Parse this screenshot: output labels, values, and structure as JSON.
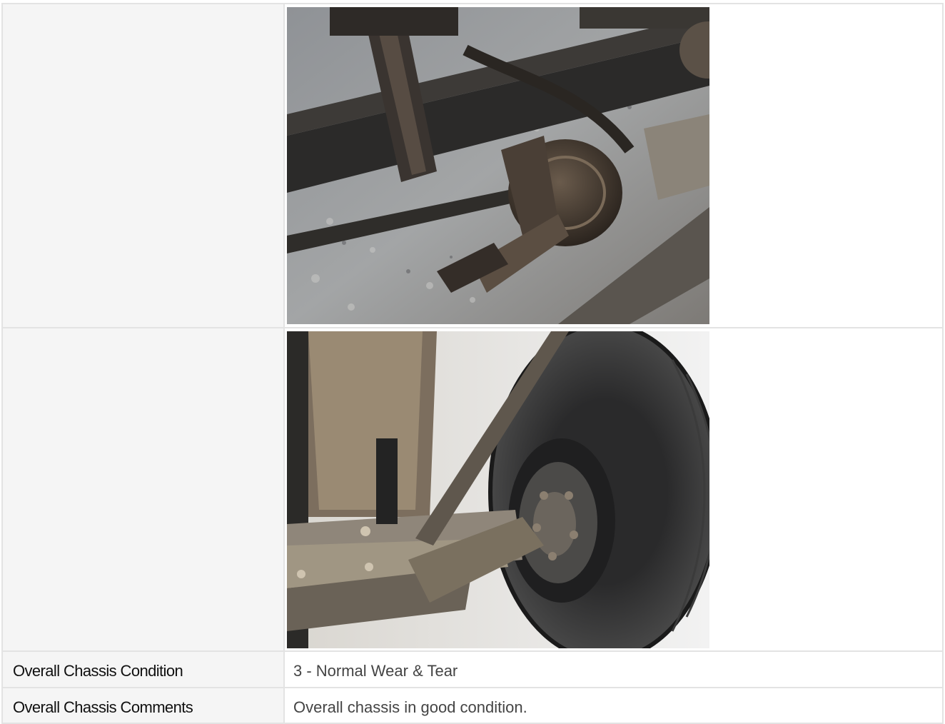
{
  "rows": [
    {
      "type": "photo",
      "photo": {
        "icon": "chassis-brake-chamber-photo"
      }
    },
    {
      "type": "photo",
      "photo": {
        "icon": "front-axle-wheel-photo"
      }
    },
    {
      "type": "field",
      "label": "Overall Chassis Condition",
      "value": "3 - Normal Wear & Tear"
    },
    {
      "type": "field",
      "label": "Overall Chassis Comments",
      "value": "Overall chassis in good condition."
    }
  ],
  "colors": {
    "border": "#e3e3e3",
    "label_bg": "#f5f5f5",
    "label_text": "#111111",
    "value_text": "#444444"
  }
}
